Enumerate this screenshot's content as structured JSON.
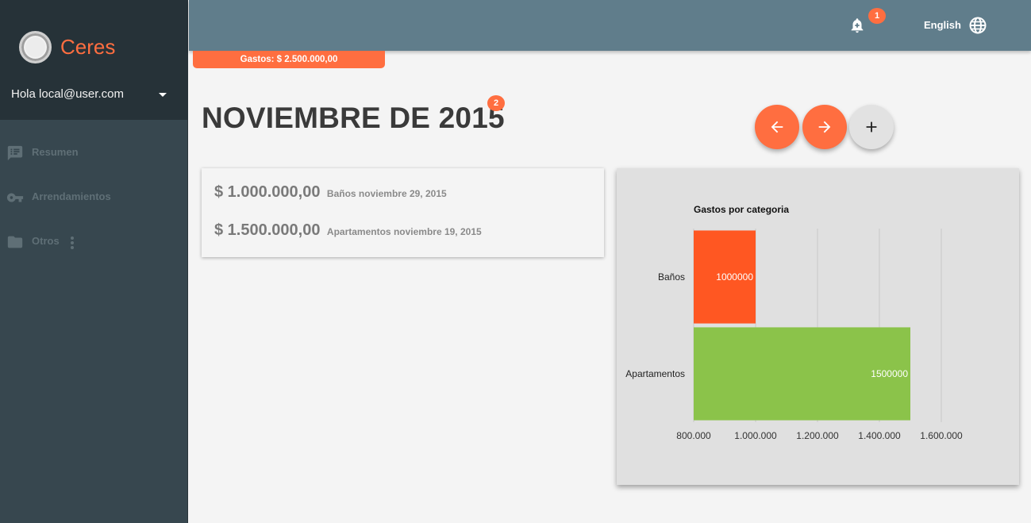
{
  "app": {
    "name": "Ceres"
  },
  "user": {
    "greeting": "Hola local@user.com"
  },
  "nav": {
    "items": [
      {
        "label": "Resumen",
        "icon": "list-icon"
      },
      {
        "label": "Arrendamientos",
        "icon": "key-icon"
      },
      {
        "label": "Otros",
        "icon": "folder-icon"
      }
    ]
  },
  "topbar": {
    "notification_count": "1",
    "language": "English"
  },
  "gastos_banner": "Gastos: $ 2.500.000,00",
  "page": {
    "title": "NOVIEMBRE DE 2015",
    "badge_count": "2"
  },
  "expenses": [
    {
      "amount": "$ 1.000.000,00",
      "description": "Baños noviembre 29, 2015"
    },
    {
      "amount": "$ 1.500.000,00",
      "description": "Apartamentos noviembre 19, 2015"
    }
  ],
  "colors": {
    "accent": "#ff6e40",
    "topbar": "#607d8b",
    "sidebar": "#37474f",
    "bar_banos": "#ff5722",
    "bar_apartamentos": "#8bc34a"
  },
  "chart_data": {
    "type": "bar",
    "orientation": "horizontal",
    "title": "Gastos por categoria",
    "categories": [
      "Baños",
      "Apartamentos"
    ],
    "values": [
      1000000,
      1500000
    ],
    "data_labels": [
      "1000000",
      "1500000"
    ],
    "bar_colors": [
      "#ff5722",
      "#8bc34a"
    ],
    "xlim": [
      800000,
      1600000
    ],
    "xticks": [
      800000,
      1000000,
      1200000,
      1400000,
      1600000
    ],
    "xtick_labels": [
      "800.000",
      "1.000.000",
      "1.200.000",
      "1.400.000",
      "1.600.000"
    ],
    "grid": true,
    "legend": "none"
  }
}
